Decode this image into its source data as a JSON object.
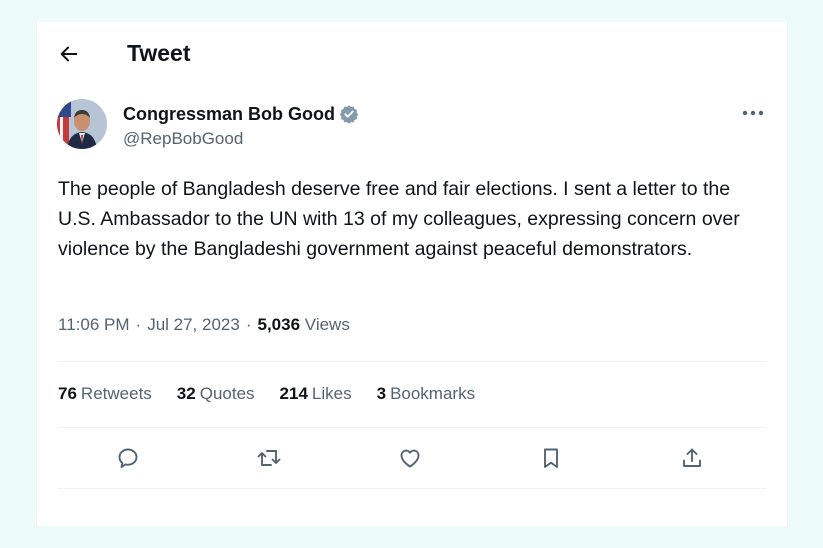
{
  "header": {
    "title": "Tweet"
  },
  "author": {
    "display_name": "Congressman Bob Good",
    "handle": "@RepBobGood",
    "verified": true,
    "verified_color": "#829aab"
  },
  "tweet": {
    "text": "The people of Bangladesh deserve free and fair elections. I sent a letter to the U.S. Ambassador to the UN with 13 of my colleagues, expressing concern over violence by the Bangladeshi government against peaceful demonstrators.",
    "time": "11:06 PM",
    "date": "Jul 27, 2023",
    "separator": "·",
    "views_count": "5,036",
    "views_label": "Views"
  },
  "stats": {
    "retweets_count": "76",
    "retweets_label": "Retweets",
    "quotes_count": "32",
    "quotes_label": "Quotes",
    "likes_count": "214",
    "likes_label": "Likes",
    "bookmarks_count": "3",
    "bookmarks_label": "Bookmarks"
  },
  "actions": [
    "reply-icon",
    "retweet-icon",
    "like-icon",
    "bookmark-icon",
    "share-icon"
  ],
  "colors": {
    "text": "#0f1419",
    "secondary": "#536471",
    "divider": "#eff3f4",
    "page_bg": "#eefbfb"
  }
}
